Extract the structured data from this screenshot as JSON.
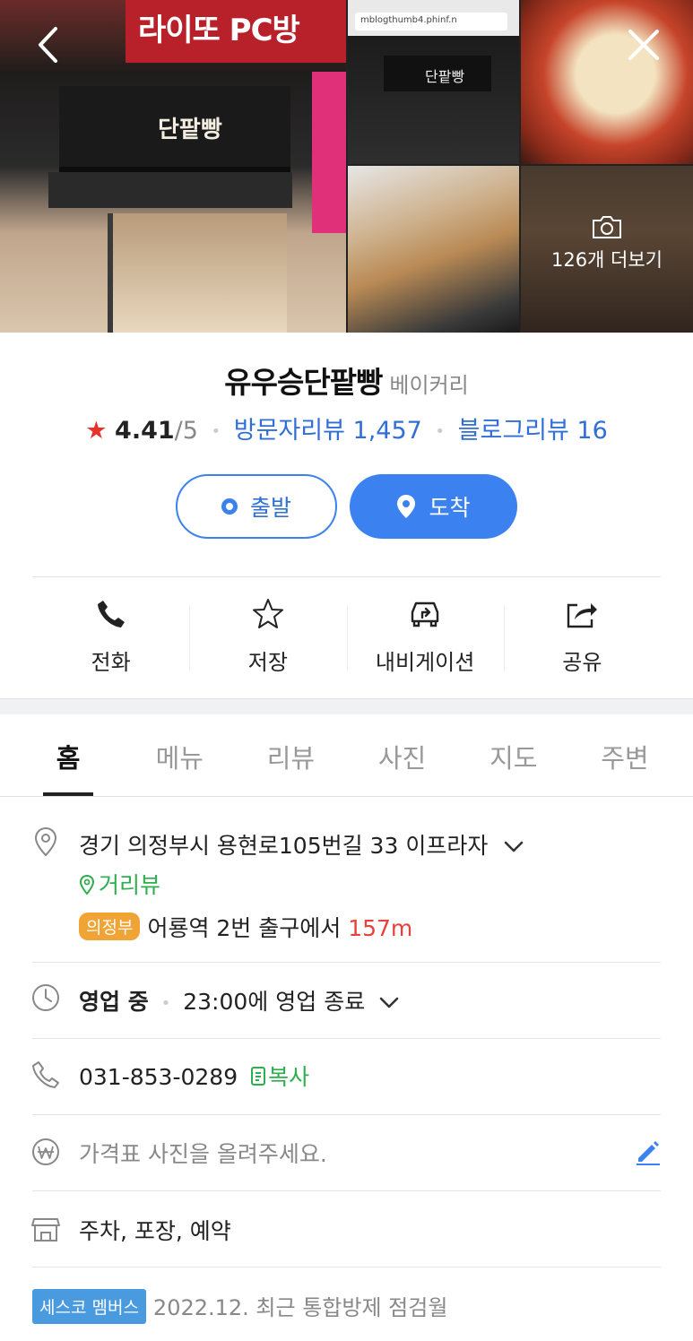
{
  "header": {
    "back_icon": "chevron-left-icon",
    "close_icon": "close-icon",
    "more_photos_label": "126개 더보기",
    "browser_url": "mblogthumb4.phinf.n",
    "storefront_sign": "단팥빵",
    "banner_text": "라이또 PC방"
  },
  "place": {
    "name": "유우승단팥빵",
    "category": "베이커리",
    "rating": "4.41",
    "rating_max": "/5",
    "visitor_review_label": "방문자리뷰 1,457",
    "blog_review_label": "블로그리뷰 16"
  },
  "route": {
    "start_label": "출발",
    "end_label": "도착"
  },
  "actions": [
    {
      "label": "전화",
      "icon": "phone-icon"
    },
    {
      "label": "저장",
      "icon": "star-icon"
    },
    {
      "label": "내비게이션",
      "icon": "car-navigation-icon"
    },
    {
      "label": "공유",
      "icon": "share-icon"
    }
  ],
  "tabs": [
    {
      "label": "홈",
      "active": true
    },
    {
      "label": "메뉴"
    },
    {
      "label": "리뷰"
    },
    {
      "label": "사진"
    },
    {
      "label": "지도"
    },
    {
      "label": "주변"
    }
  ],
  "info": {
    "address": "경기 의정부시 용현로105번길 33 이프라자",
    "street_view_label": "거리뷰",
    "subway_line_badge": "의정부",
    "subway_directions": "어룡역 2번 출구에서",
    "subway_distance": "157m",
    "hours_status": "영업 중",
    "hours_detail": "23:00에 영업 종료",
    "phone": "031-853-0289",
    "copy_label": "복사",
    "price_placeholder": "가격표 사진을 올려주세요.",
    "amenities": "주차, 포장, 예약",
    "sesco_badge": "세스코 멤버스",
    "sesco_text": "2022.12. 최근 통합방제 점검월"
  },
  "colors": {
    "accent_blue": "#3b82f0",
    "link_blue": "#2f6fd6",
    "star_red": "#e8322a",
    "green": "#2eae4e",
    "distance_red": "#e8413a",
    "badge_orange": "#f0a436",
    "badge_blue": "#4a9ae0"
  }
}
